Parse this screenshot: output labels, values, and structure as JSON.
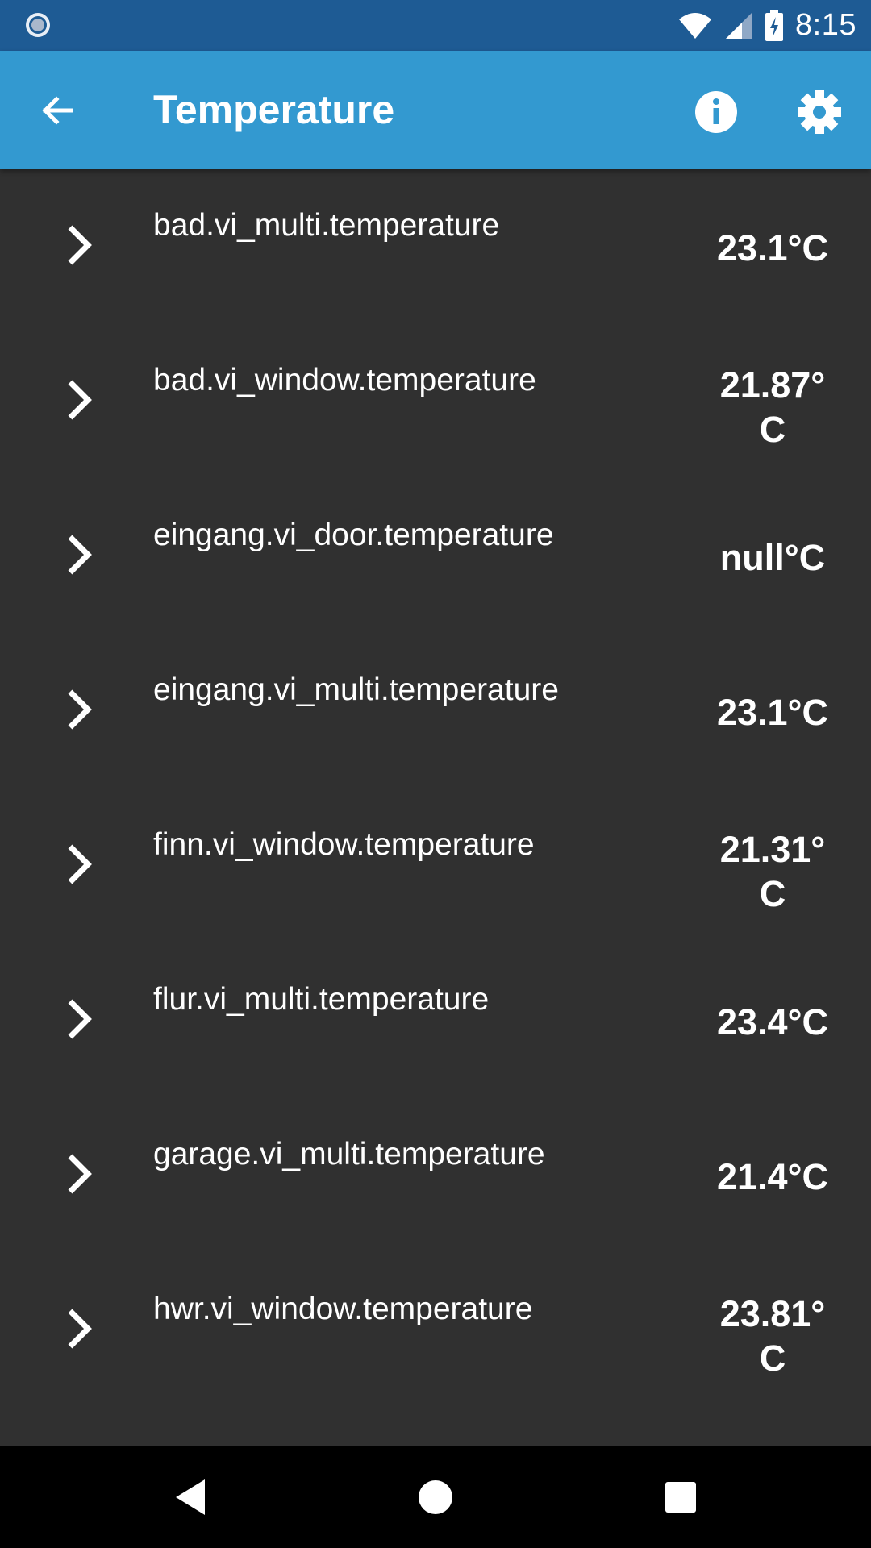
{
  "status_bar": {
    "time": "8:15",
    "icons": [
      "notification-circle-icon",
      "wifi-icon",
      "cell-signal-icon",
      "battery-charging-icon"
    ]
  },
  "app_bar": {
    "title": "Temperature",
    "back_icon": "arrow-back-icon",
    "info_icon": "info-icon",
    "settings_icon": "gear-icon"
  },
  "list": {
    "items": [
      {
        "name": "bad.vi_multi.temperature",
        "value": "23.1°C"
      },
      {
        "name": "bad.vi_window.temperature",
        "value": "21.87°C"
      },
      {
        "name": "eingang.vi_door.temperature",
        "value": "null°C"
      },
      {
        "name": "eingang.vi_multi.temperature",
        "value": "23.1°C"
      },
      {
        "name": "finn.vi_window.temperature",
        "value": "21.31°C"
      },
      {
        "name": "flur.vi_multi.temperature",
        "value": "23.4°C"
      },
      {
        "name": "garage.vi_multi.temperature",
        "value": "21.4°C"
      },
      {
        "name": "hwr.vi_window.temperature",
        "value": "23.81°C"
      }
    ]
  },
  "nav_bar": {
    "icons": [
      "back-triangle-icon",
      "home-circle-icon",
      "recents-square-icon"
    ]
  },
  "colors": {
    "status_bar": "#1e5b94",
    "app_bar": "#3399d0",
    "background": "#303030",
    "nav_bar": "#000000",
    "text": "#ffffff"
  }
}
